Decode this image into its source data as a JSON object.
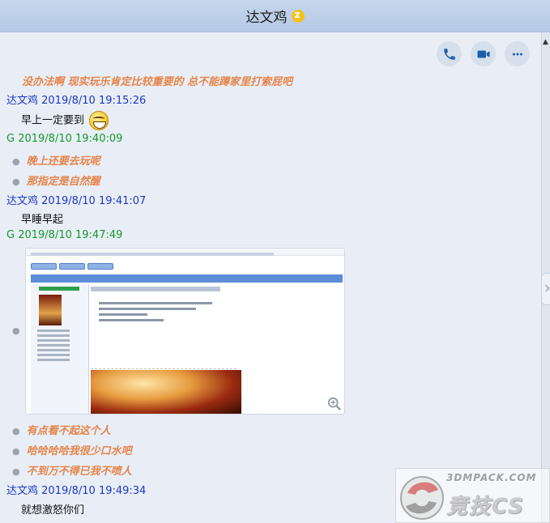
{
  "window": {
    "title": "达文鸡"
  },
  "toolbar": {
    "call_icon": "phone-icon",
    "video_icon": "video-camera-icon",
    "more_icon": "more-icon"
  },
  "messages": [
    {
      "type": "text-italic",
      "text": "没办法啊 现实玩乐肯定比较重要的 总不能蹲家里打索屁吧"
    },
    {
      "type": "sender",
      "sender": "达文鸡",
      "time": "2019/8/10 19:15:26"
    },
    {
      "type": "text",
      "text": "早上一定要到"
    },
    {
      "type": "sender",
      "sender": "G",
      "time": "2019/8/10 19:40:09"
    },
    {
      "type": "text-italic",
      "text": "晚上还要去玩呢"
    },
    {
      "type": "text-italic",
      "text": "那指定是自然醒"
    },
    {
      "type": "sender",
      "sender": "达文鸡",
      "time": "2019/8/10 19:41:07"
    },
    {
      "type": "text",
      "text": "早睡早起"
    },
    {
      "type": "sender",
      "sender": "G",
      "time": "2019/8/10 19:47:49"
    },
    {
      "type": "text-italic",
      "text": "有点看不起这个人"
    },
    {
      "type": "text-italic",
      "text": "哈哈哈哈我很少口水吧"
    },
    {
      "type": "text-italic",
      "text": "不到万不得已我不喷人"
    },
    {
      "type": "sender",
      "sender": "达文鸡",
      "time": "2019/8/10 19:49:34"
    },
    {
      "type": "text",
      "text": "就想激怒你们"
    }
  ],
  "attachment": {
    "username": "yunen_de_tan",
    "zoom_icon": "zoom-in-icon"
  },
  "watermark": {
    "site": "3DMPACK.COM",
    "label": "竞技CS"
  },
  "colors": {
    "sender_a": "#1b37c8",
    "sender_g": "#149a2c",
    "italic_text": "#e5854b",
    "title_bar": "#b4c9e4",
    "background": "#e9eef6"
  }
}
